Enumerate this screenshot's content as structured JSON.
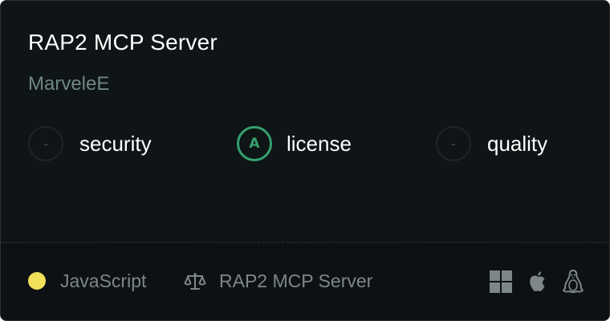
{
  "card": {
    "title": "RAP2 MCP Server",
    "author": "MarveleE"
  },
  "scores": [
    {
      "grade": "-",
      "label": "security"
    },
    {
      "grade": "A",
      "label": "license"
    },
    {
      "grade": "-",
      "label": "quality"
    }
  ],
  "footer": {
    "language": "JavaScript",
    "language_color": "#f1e05a",
    "license_icon": "scale-icon",
    "license_name": "RAP2 MCP Server",
    "platforms": [
      "windows-icon",
      "apple-icon",
      "linux-icon"
    ]
  },
  "colors": {
    "background": "#0f1416",
    "grade_a": "#33a26d",
    "muted_text": "#7d8789"
  }
}
